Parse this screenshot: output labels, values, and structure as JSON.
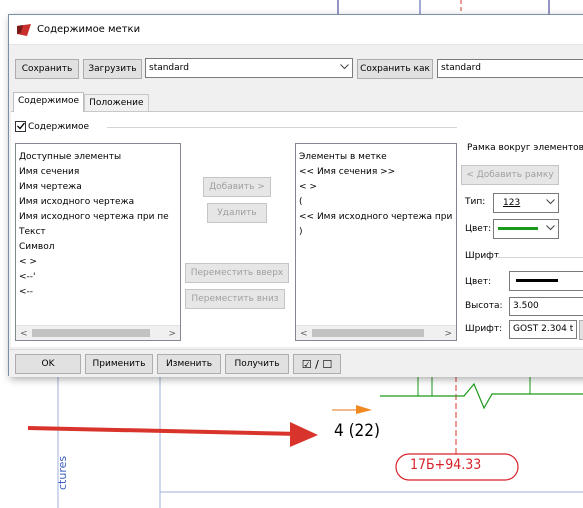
{
  "dialog": {
    "title": "Содержимое метки",
    "toolbar": {
      "save_label": "Сохранить",
      "load_label": "Загрузить",
      "preset_value": "standard",
      "save_as_label": "Сохранить как",
      "save_as_value": "standard"
    },
    "tabs": [
      {
        "label": "Содержимое",
        "active": true
      },
      {
        "label": "Положение",
        "active": false
      }
    ],
    "content_checkbox": {
      "label": "Содержимое",
      "checked": true
    },
    "available": {
      "header": "Доступные элементы",
      "items": [
        "Имя сечения",
        "Имя чертежа",
        "Имя исходного чертежа",
        "Имя исходного чертежа при пе",
        "Текст",
        "Символ",
        "< >",
        "<--'",
        "<--"
      ]
    },
    "middle_buttons": {
      "add": "Добавить >",
      "remove": "Удалить",
      "move_up": "Переместить вверх",
      "move_down": "Переместить вниз"
    },
    "in_label": {
      "header": "Элементы в метке",
      "items": [
        "<< Имя сечения >>",
        "< >",
        "(",
        "<< Имя исходного чертежа при",
        ")"
      ]
    },
    "frame": {
      "header": "Рамка вокруг элементов",
      "add_frame": "< Добавить рамку",
      "type_label": "Тип:",
      "type_value": "123",
      "color_label": "Цвет:"
    },
    "font": {
      "header": "Шрифт",
      "color_label": "Цвет:",
      "height_label": "Высота:",
      "height_value": "3.500",
      "font_label": "Шрифт:",
      "font_value": "GOST 2.304 t"
    },
    "bottom": {
      "ok": "OK",
      "apply": "Применить",
      "modify": "Изменить",
      "get": "Получить",
      "toggle": "☑ / ☐"
    }
  },
  "drawing": {
    "label_text": "4 (22)",
    "station_text": "17Б+94.33",
    "side_text": "ctures"
  },
  "colors": {
    "arrow": "#d9342b",
    "station": "#d8222a",
    "green_line": "#1a9a1a",
    "accent_icon": "#c9302c"
  }
}
